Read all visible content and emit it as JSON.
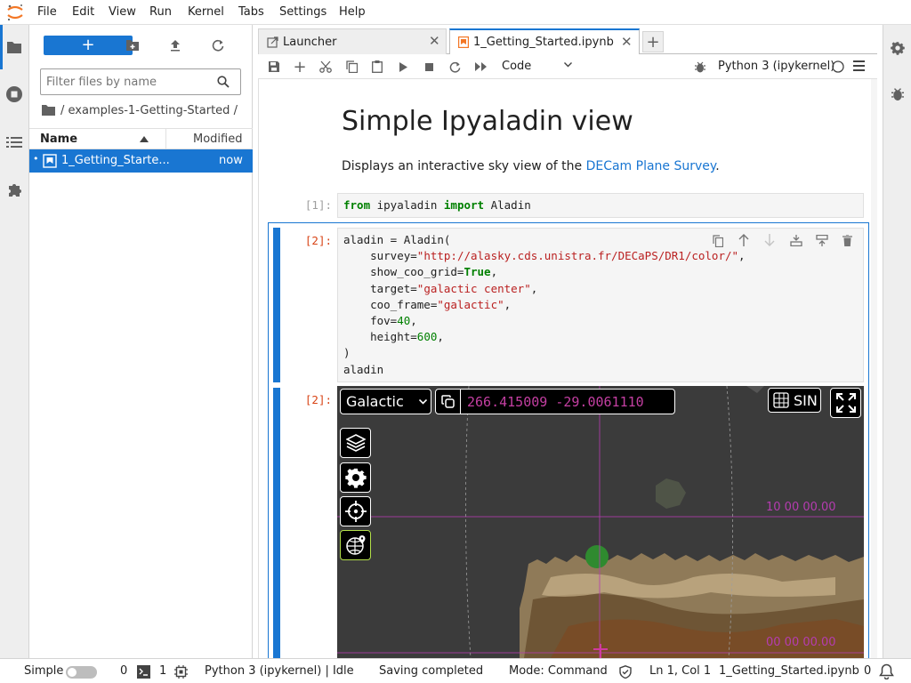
{
  "menu": [
    "File",
    "Edit",
    "View",
    "Run",
    "Kernel",
    "Tabs",
    "Settings",
    "Help"
  ],
  "filebrowser": {
    "new_label": "+",
    "filter_placeholder": "Filter files by name",
    "breadcrumb": "/ examples-1-Getting-Started /",
    "col_name": "Name",
    "col_modified": "Modified",
    "files": [
      {
        "name": "1_Getting_Starte...",
        "modified": "now",
        "selected": true
      }
    ]
  },
  "tabs": [
    {
      "label": "Launcher",
      "icon": "launcher-icon",
      "active": false
    },
    {
      "label": "1_Getting_Started.ipynb",
      "icon": "notebook-icon",
      "active": true
    }
  ],
  "toolbar": {
    "cell_type": "Code",
    "kernel_name": "Python 3 (ipykernel)"
  },
  "notebook": {
    "title": "Simple Ipyaladin view",
    "desc_prefix": "Displays an interactive sky view of the ",
    "desc_link": "DECam Plane Survey",
    "desc_suffix": ".",
    "cell1_prompt": "[1]:",
    "cell1_code": {
      "kw1": "from",
      "mod": " ipyaladin ",
      "kw2": "import",
      "name": " Aladin"
    },
    "cell2_prompt": "[2]:",
    "cell2_lines": [
      "aladin = Aladin(",
      "    survey=",
      "    show_coo_grid=",
      "    target=",
      "    coo_frame=",
      "    fov=",
      "    height=",
      ")",
      "aladin"
    ],
    "cell2_values": {
      "survey": "\"http://alasky.cds.unistra.fr/DECaPS/DR1/color/\"",
      "show_coo_grid": "True",
      "target": "\"galactic center\"",
      "coo_frame": "\"galactic\"",
      "fov": "40",
      "height": "600"
    },
    "output_prompt": "[2]:",
    "aladin": {
      "frame": "Galactic",
      "coords": "266.415009 -29.0061110",
      "projection": "SIN",
      "grid_label_1": "10 00 00.00",
      "grid_label_2": "00 00 00.00"
    }
  },
  "status": {
    "mode_label": "Simple",
    "count_a": "0",
    "count_b": "1",
    "kernel_status": "Python 3 (ipykernel) | Idle",
    "save_status": "Saving completed",
    "mode": "Mode: Command",
    "position": "Ln 1, Col 1",
    "filename": "1_Getting_Started.ipynb",
    "notifications": "0"
  },
  "colors": {
    "accent": "#1976d2",
    "aladin_coord": "#c43fa2",
    "aladin_grid": "#b53cb0"
  }
}
